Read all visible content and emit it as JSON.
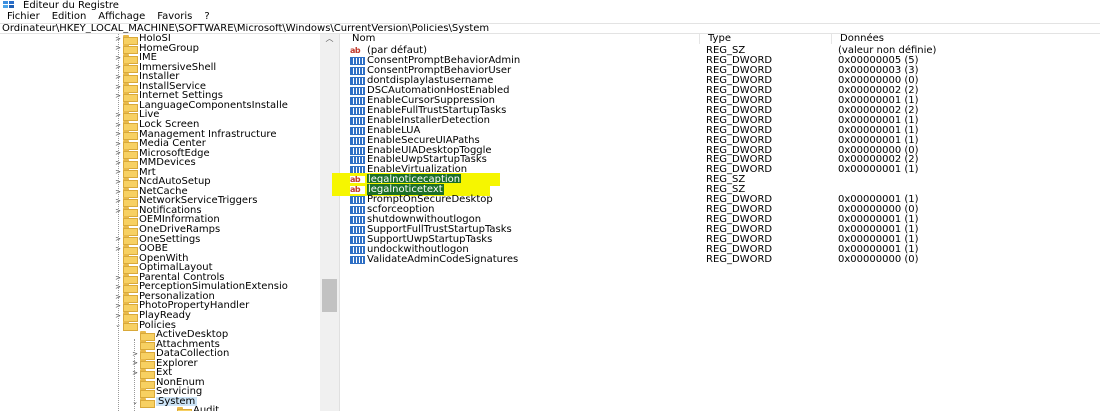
{
  "window": {
    "title": "Éditeur du Registre",
    "menu": [
      "Fichier",
      "Edition",
      "Affichage",
      "Favoris",
      "?"
    ],
    "address": "Ordinateur\\HKEY_LOCAL_MACHINE\\SOFTWARE\\Microsoft\\Windows\\CurrentVersion\\Policies\\System"
  },
  "colors": {
    "selected_value_bg": "#1d6f28",
    "highlighter": "#f6f600",
    "folder": "#f7d062",
    "tree_selected_bg": "#cce4f7"
  },
  "tree": {
    "items": [
      {
        "label": "HoloSI",
        "expander": ">"
      },
      {
        "label": "HomeGroup",
        "expander": ">"
      },
      {
        "label": "IME",
        "expander": ">"
      },
      {
        "label": "ImmersiveShell",
        "expander": ">"
      },
      {
        "label": "Installer",
        "expander": ">"
      },
      {
        "label": "InstallService",
        "expander": ">"
      },
      {
        "label": "Internet Settings",
        "expander": ">"
      },
      {
        "label": "LanguageComponentsInstalle",
        "expander": ""
      },
      {
        "label": "Live",
        "expander": ">"
      },
      {
        "label": "Lock Screen",
        "expander": ">"
      },
      {
        "label": "Management Infrastructure",
        "expander": ">"
      },
      {
        "label": "Media Center",
        "expander": ">"
      },
      {
        "label": "MicrosoftEdge",
        "expander": ">"
      },
      {
        "label": "MMDevices",
        "expander": ">"
      },
      {
        "label": "Mrt",
        "expander": ">"
      },
      {
        "label": "NcdAutoSetup",
        "expander": ">"
      },
      {
        "label": "NetCache",
        "expander": ">"
      },
      {
        "label": "NetworkServiceTriggers",
        "expander": ">"
      },
      {
        "label": "Notifications",
        "expander": ">"
      },
      {
        "label": "OEMInformation",
        "expander": ""
      },
      {
        "label": "OneDriveRamps",
        "expander": ""
      },
      {
        "label": "OneSettings",
        "expander": ">"
      },
      {
        "label": "OOBE",
        "expander": ">"
      },
      {
        "label": "OpenWith",
        "expander": ""
      },
      {
        "label": "OptimalLayout",
        "expander": ""
      },
      {
        "label": "Parental Controls",
        "expander": ">"
      },
      {
        "label": "PerceptionSimulationExtensio",
        "expander": ">"
      },
      {
        "label": "Personalization",
        "expander": ">"
      },
      {
        "label": "PhotoPropertyHandler",
        "expander": ">"
      },
      {
        "label": "PlayReady",
        "expander": ">"
      },
      {
        "label": "Policies",
        "expander": "⌄"
      },
      {
        "label": "ActiveDesktop",
        "expander": "",
        "child": true
      },
      {
        "label": "Attachments",
        "expander": "",
        "child": true
      },
      {
        "label": "DataCollection",
        "expander": ">",
        "child": true
      },
      {
        "label": "Explorer",
        "expander": ">",
        "child": true
      },
      {
        "label": "Ext",
        "expander": ">",
        "child": true
      },
      {
        "label": "NonEnum",
        "expander": "",
        "child": true
      },
      {
        "label": "Servicing",
        "expander": "",
        "child": true
      },
      {
        "label": "System",
        "expander": "⌄",
        "child": true,
        "selected": true
      },
      {
        "label": "Audit",
        "expander": "",
        "grandchild": true
      }
    ]
  },
  "list": {
    "headers": [
      "Nom",
      "Type",
      "Données"
    ],
    "rows": [
      {
        "icon": "string-value-icon",
        "name": "(par défaut)",
        "type": "REG_SZ",
        "data": "(valeur non définie)"
      },
      {
        "icon": "dword-value-icon",
        "name": "ConsentPromptBehaviorAdmin",
        "type": "REG_DWORD",
        "data": "0x00000005 (5)"
      },
      {
        "icon": "dword-value-icon",
        "name": "ConsentPromptBehaviorUser",
        "type": "REG_DWORD",
        "data": "0x00000003 (3)"
      },
      {
        "icon": "dword-value-icon",
        "name": "dontdisplaylastusername",
        "type": "REG_DWORD",
        "data": "0x00000000 (0)"
      },
      {
        "icon": "dword-value-icon",
        "name": "DSCAutomationHostEnabled",
        "type": "REG_DWORD",
        "data": "0x00000002 (2)"
      },
      {
        "icon": "dword-value-icon",
        "name": "EnableCursorSuppression",
        "type": "REG_DWORD",
        "data": "0x00000001 (1)"
      },
      {
        "icon": "dword-value-icon",
        "name": "EnableFullTrustStartupTasks",
        "type": "REG_DWORD",
        "data": "0x00000002 (2)"
      },
      {
        "icon": "dword-value-icon",
        "name": "EnableInstallerDetection",
        "type": "REG_DWORD",
        "data": "0x00000001 (1)"
      },
      {
        "icon": "dword-value-icon",
        "name": "EnableLUA",
        "type": "REG_DWORD",
        "data": "0x00000001 (1)"
      },
      {
        "icon": "dword-value-icon",
        "name": "EnableSecureUIAPaths",
        "type": "REG_DWORD",
        "data": "0x00000001 (1)"
      },
      {
        "icon": "dword-value-icon",
        "name": "EnableUIADesktopToggle",
        "type": "REG_DWORD",
        "data": "0x00000000 (0)"
      },
      {
        "icon": "dword-value-icon",
        "name": "EnableUwpStartupTasks",
        "type": "REG_DWORD",
        "data": "0x00000002 (2)"
      },
      {
        "icon": "dword-value-icon",
        "name": "EnableVirtualization",
        "type": "REG_DWORD",
        "data": "0x00000001 (1)"
      },
      {
        "icon": "string-value-icon",
        "name": "legalnoticecaption",
        "type": "REG_SZ",
        "data": "",
        "selected": true,
        "highlighted": true
      },
      {
        "icon": "string-value-icon",
        "name": "legalnoticetext",
        "type": "REG_SZ",
        "data": "",
        "selected": true,
        "highlighted": true
      },
      {
        "icon": "dword-value-icon",
        "name": "PromptOnSecureDesktop",
        "type": "REG_DWORD",
        "data": "0x00000001 (1)"
      },
      {
        "icon": "dword-value-icon",
        "name": "scforceoption",
        "type": "REG_DWORD",
        "data": "0x00000000 (0)"
      },
      {
        "icon": "dword-value-icon",
        "name": "shutdownwithoutlogon",
        "type": "REG_DWORD",
        "data": "0x00000001 (1)"
      },
      {
        "icon": "dword-value-icon",
        "name": "SupportFullTrustStartupTasks",
        "type": "REG_DWORD",
        "data": "0x00000001 (1)"
      },
      {
        "icon": "dword-value-icon",
        "name": "SupportUwpStartupTasks",
        "type": "REG_DWORD",
        "data": "0x00000001 (1)"
      },
      {
        "icon": "dword-value-icon",
        "name": "undockwithoutlogon",
        "type": "REG_DWORD",
        "data": "0x00000001 (1)"
      },
      {
        "icon": "dword-value-icon",
        "name": "ValidateAdminCodeSignatures",
        "type": "REG_DWORD",
        "data": "0x00000000 (0)"
      }
    ]
  }
}
